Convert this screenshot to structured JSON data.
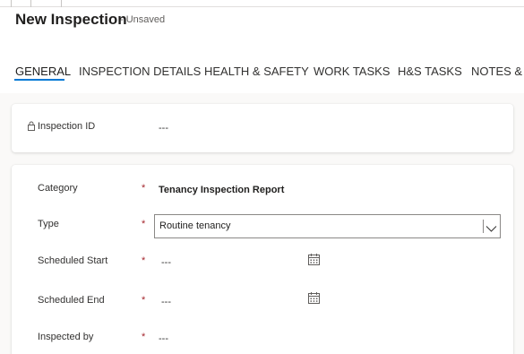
{
  "header": {
    "title": "New Inspection",
    "status": "- Unsaved"
  },
  "tabs": [
    {
      "label": "GENERAL",
      "active": true
    },
    {
      "label": "INSPECTION DETAILS",
      "active": false
    },
    {
      "label": "HEALTH & SAFETY",
      "active": false
    },
    {
      "label": "WORK TASKS",
      "active": false
    },
    {
      "label": "H&S TASKS",
      "active": false
    },
    {
      "label": "NOTES & A",
      "active": false
    }
  ],
  "inspection_id": {
    "label": "Inspection ID",
    "value": "---",
    "icon": "lock-icon"
  },
  "form": {
    "required_marker": "*",
    "category": {
      "label": "Category",
      "value": "Tenancy Inspection Report"
    },
    "type": {
      "label": "Type",
      "value": "Routine tenancy",
      "icon": "chevron-down-icon"
    },
    "scheduled_start": {
      "label": "Scheduled Start",
      "value": "---",
      "icon": "calendar-icon"
    },
    "scheduled_end": {
      "label": "Scheduled End",
      "value": "---",
      "icon": "calendar-icon"
    },
    "inspected_by": {
      "label": "Inspected by",
      "value": "---"
    }
  },
  "colors": {
    "accent": "#0078d4",
    "required": "#a4262c",
    "background": "#faf9f8"
  }
}
